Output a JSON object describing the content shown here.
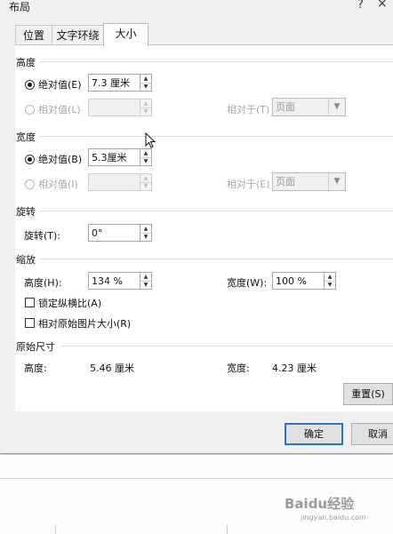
{
  "dialog": {
    "title": "布局",
    "help": "?",
    "close": "×"
  },
  "tabs": [
    {
      "label": "位置",
      "active": false
    },
    {
      "label": "文字环绕",
      "active": false
    },
    {
      "label": "大小",
      "active": true
    }
  ],
  "height_section": {
    "title": "高度",
    "absolute_label": "绝对值(E)",
    "absolute_value": "7.3 厘米",
    "relative_label": "相对值(L)",
    "relative_value": "",
    "relative_to_label": "相对于(T)",
    "relative_to_value": "页面"
  },
  "width_section": {
    "title": "宽度",
    "absolute_label": "绝对值(B)",
    "absolute_value": "5.3厘米",
    "relative_label": "相对值(I)",
    "relative_value": "",
    "relative_to_label": "相对于(E)",
    "relative_to_value": "页面"
  },
  "rotation_section": {
    "title": "旋转",
    "rotation_label": "旋转(T):",
    "rotation_value": "0°"
  },
  "scale_section": {
    "title": "缩放",
    "height_label": "高度(H):",
    "height_value": "134 %",
    "width_label": "宽度(W):",
    "width_value": "100 %",
    "lock_aspect_label": "锁定纵横比(A)",
    "relative_original_label": "相对原始图片大小(R)"
  },
  "original_section": {
    "title": "原始尺寸",
    "height_label": "高度:",
    "height_value": "5.46 厘米",
    "width_label": "宽度:",
    "width_value": "4.23 厘米"
  },
  "buttons": {
    "reset": "重置(S)",
    "ok": "确定",
    "cancel": "取消"
  },
  "watermark": {
    "brand": "Baidu经验",
    "url": "jingyan.baidu.com"
  }
}
